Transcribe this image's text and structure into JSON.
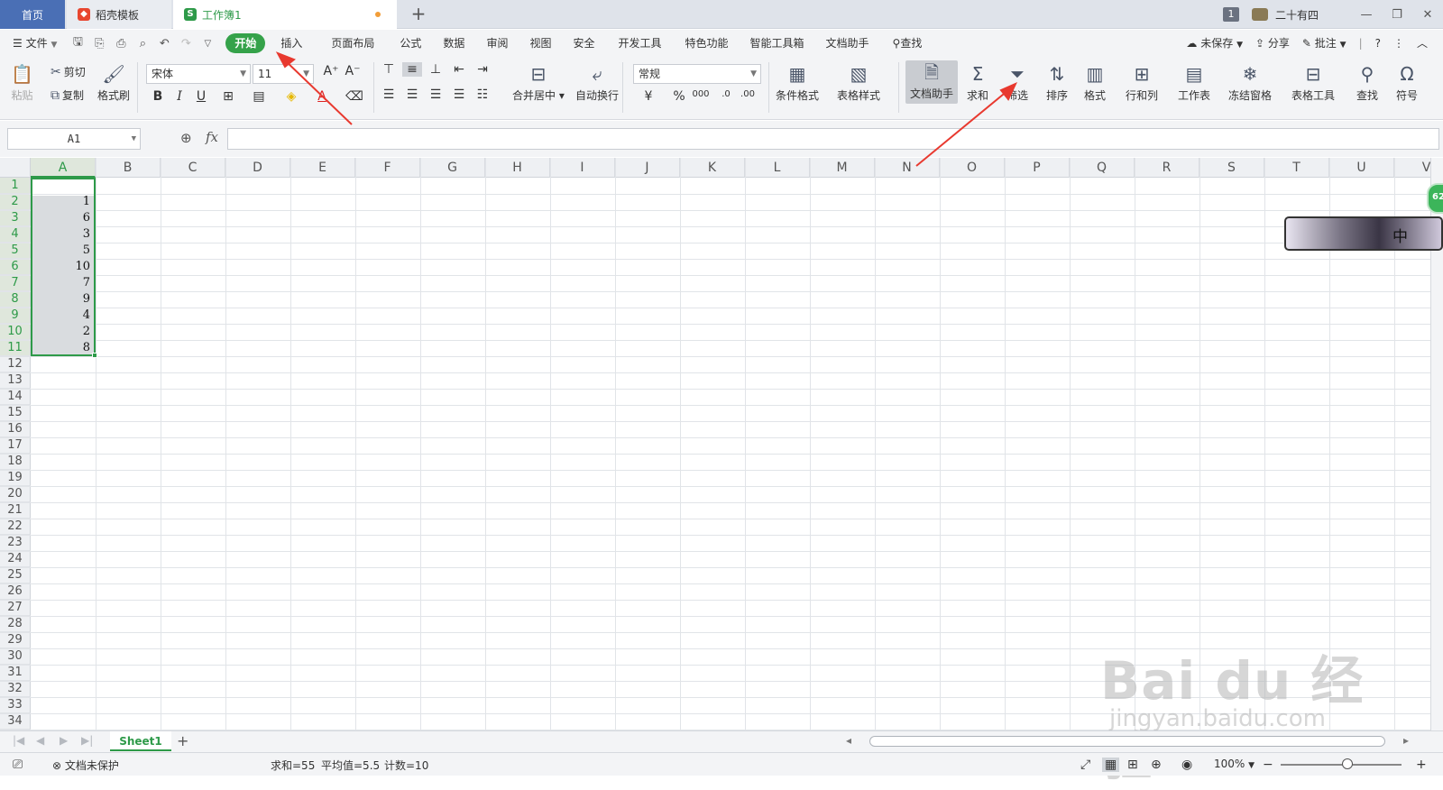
{
  "tabs": [
    {
      "label": "首页"
    },
    {
      "label": "稻壳模板"
    },
    {
      "label": "工作簿1"
    }
  ],
  "titlebar": {
    "badge": "1",
    "username": "二十有四"
  },
  "menu": {
    "file": "文件",
    "items": [
      "开始",
      "插入",
      "页面布局",
      "公式",
      "数据",
      "审阅",
      "视图",
      "安全",
      "开发工具",
      "特色功能",
      "智能工具箱",
      "文档助手"
    ],
    "search": "查找",
    "unsaved": "未保存",
    "share": "分享",
    "comment": "批注"
  },
  "ribbon": {
    "paste": "粘贴",
    "cut": "剪切",
    "copy": "复制",
    "format_painter": "格式刷",
    "font_name": "宋体",
    "font_size": "11",
    "merge_center": "合并居中",
    "wrap_text": "自动换行",
    "number_format": "常规",
    "cond_format": "条件格式",
    "table_style": "表格样式",
    "doc_assist": "文档助手",
    "sum": "求和",
    "filter": "筛选",
    "sort": "排序",
    "format": "格式",
    "rows_cols": "行和列",
    "worksheet": "工作表",
    "freeze": "冻结窗格",
    "table_tools": "表格工具",
    "find": "查找",
    "symbol": "符号"
  },
  "formula": {
    "cell_ref": "A1",
    "fx": "fx",
    "content": ""
  },
  "columns": [
    "A",
    "B",
    "C",
    "D",
    "E",
    "F",
    "G",
    "H",
    "I",
    "J",
    "K",
    "L",
    "M",
    "N",
    "O",
    "P",
    "Q",
    "R",
    "S",
    "T",
    "U",
    "V"
  ],
  "rows_visible": 34,
  "column_A_values": [
    "",
    "1",
    "6",
    "3",
    "5",
    "10",
    "7",
    "9",
    "4",
    "2",
    "8"
  ],
  "sheet": {
    "name": "Sheet1"
  },
  "status": {
    "protect": "文档未保护",
    "sum": "求和=55",
    "avg": "平均值=5.5",
    "count": "计数=10",
    "zoom": "100%"
  },
  "widget": {
    "ime": "中",
    "ball": "62"
  },
  "watermark": {
    "brand": "Bai du 经验",
    "url": "jingyan.baidu.com"
  },
  "colors": {
    "accent": "#2e9a49",
    "annotation": "#e8392f",
    "home_tab": "#4a6fb5"
  }
}
